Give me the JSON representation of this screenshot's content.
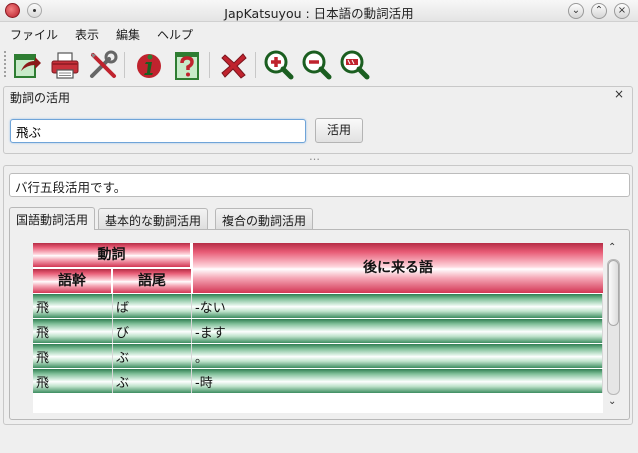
{
  "window": {
    "title": "JapKatsuyou : 日本語の動詞活用",
    "controls": [
      "minimize",
      "maximize",
      "close"
    ]
  },
  "menubar": {
    "items": [
      "ファイル",
      "表示",
      "編集",
      "ヘルプ"
    ]
  },
  "toolbar": {
    "icons": [
      "export-icon",
      "print-icon",
      "settings-icon",
      "info-icon",
      "help-icon",
      "clear-icon",
      "zoom-in-icon",
      "zoom-out-icon",
      "zoom-reset-icon"
    ]
  },
  "conjugation_panel": {
    "title": "動詞の活用",
    "close_label": "×",
    "input_value": "飛ぶ",
    "button_label": "活用"
  },
  "result_panel": {
    "message": "バ行五段活用です。",
    "tabs": [
      "国語動詞活用",
      "基本的な動詞活用",
      "複合の動詞活用"
    ],
    "active_tab": 0,
    "table": {
      "header_verb": "動詞",
      "header_stem": "語幹",
      "header_ending": "語尾",
      "header_following": "後に来る語",
      "rows": [
        {
          "stem": "飛",
          "ending": "ば",
          "following": "-ない"
        },
        {
          "stem": "飛",
          "ending": "び",
          "following": "-ます"
        },
        {
          "stem": "飛",
          "ending": "ぶ",
          "following": "。"
        },
        {
          "stem": "飛",
          "ending": "ぶ",
          "following": "-時"
        }
      ]
    }
  },
  "colors": {
    "header_red": "#d33654",
    "row_green": "#3d8d60",
    "input_focus": "#6fa4d8"
  }
}
